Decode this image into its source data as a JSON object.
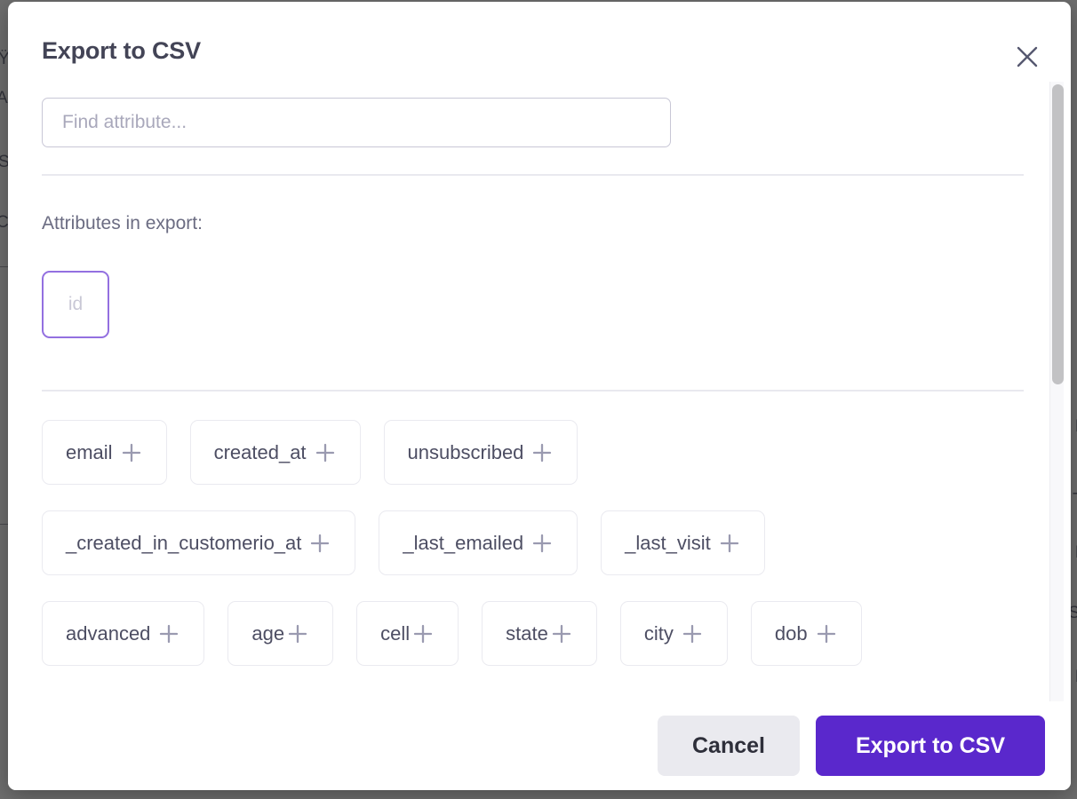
{
  "modal": {
    "title": "Export to CSV",
    "close_icon": "close-icon"
  },
  "search": {
    "placeholder": "Find attribute...",
    "value": ""
  },
  "section": {
    "label": "Attributes in export:"
  },
  "selected_attributes": [
    {
      "label": "id"
    }
  ],
  "available_attribute_rows": [
    [
      {
        "label": "email",
        "icon": "plus-icon"
      },
      {
        "label": "created_at",
        "icon": "plus-icon"
      },
      {
        "label": "unsubscribed",
        "icon": "plus-icon"
      }
    ],
    [
      {
        "label": "_created_in_customerio_at",
        "icon": "plus-icon"
      },
      {
        "label": "_last_emailed",
        "icon": "plus-icon"
      },
      {
        "label": "_last_visit",
        "icon": "plus-icon"
      }
    ],
    [
      {
        "label": "advanced",
        "icon": "plus-icon"
      },
      {
        "label": "age",
        "icon": "plus-icon"
      },
      {
        "label": "cell",
        "icon": "plus-icon"
      },
      {
        "label": "state",
        "icon": "plus-icon"
      },
      {
        "label": "city",
        "icon": "plus-icon"
      },
      {
        "label": "dob",
        "icon": "plus-icon"
      }
    ]
  ],
  "footer": {
    "cancel_label": "Cancel",
    "export_label": "Export to CSV"
  },
  "colors": {
    "primary": "#5a28cc",
    "selected_chip_border": "#9370e0",
    "title_text": "#434456",
    "muted_text": "#6b6c82",
    "chip_border": "#eaeaf0",
    "backdrop": "#6e6e6e"
  }
}
